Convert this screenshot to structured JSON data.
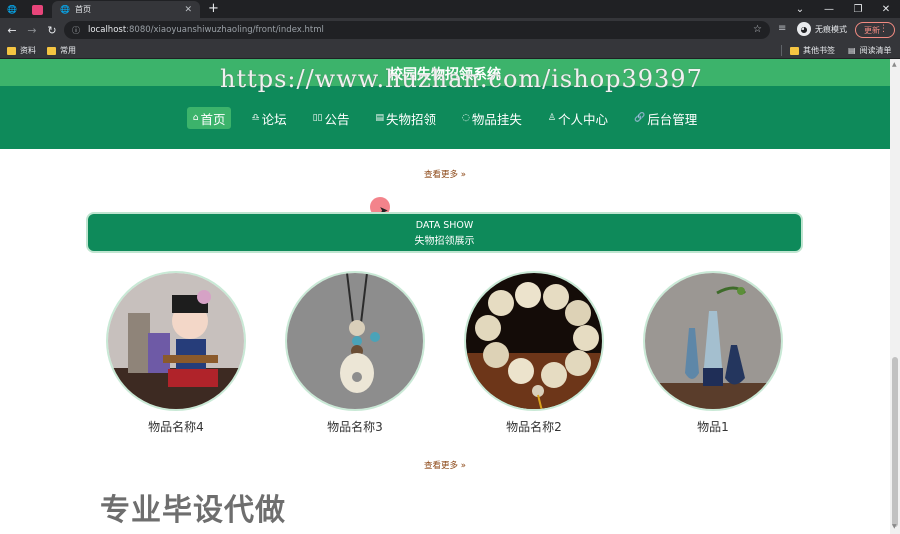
{
  "browser": {
    "tabs": [
      {
        "title": ""
      },
      {
        "title": ""
      },
      {
        "title": "首页"
      }
    ],
    "url_host": "localhost",
    "url_path": ":8080/xiaoyuanshiwuzhaoling/front/index.html",
    "incognito_label": "无痕模式",
    "update_label": "更新",
    "bookmarks": [
      {
        "label": "资料"
      },
      {
        "label": "常用"
      }
    ],
    "bookmarks_right": [
      {
        "label": "其他书签"
      },
      {
        "label": "阅读清单"
      }
    ]
  },
  "site": {
    "title": "校园失物招领系统",
    "watermark": "https://www.huzhan.com/ishop39397",
    "nav": [
      {
        "label": "首页",
        "icon": "home-icon",
        "glyph": "⌂",
        "active": true
      },
      {
        "label": "论坛",
        "icon": "forum-icon",
        "glyph": "♎",
        "active": false
      },
      {
        "label": "公告",
        "icon": "notice-icon",
        "glyph": "▯▯",
        "active": false
      },
      {
        "label": "失物招领",
        "icon": "lost-found-icon",
        "glyph": "▤",
        "active": false
      },
      {
        "label": "物品挂失",
        "icon": "report-icon",
        "glyph": "◌",
        "active": false
      },
      {
        "label": "个人中心",
        "icon": "user-icon",
        "glyph": "♙",
        "active": false
      },
      {
        "label": "后台管理",
        "icon": "link-icon",
        "glyph": "🔗",
        "active": false
      }
    ]
  },
  "main": {
    "more_top": "查看更多 »",
    "banner_en": "DATA SHOW",
    "banner_cn": "失物招领展示",
    "products": [
      {
        "name": "物品名称4"
      },
      {
        "name": "物品名称3"
      },
      {
        "name": "物品名称2"
      },
      {
        "name": "物品1"
      }
    ],
    "more_bottom": "查看更多 »",
    "overlay_text": "专业毕设代做"
  },
  "colors": {
    "header_green": "#0e8a5a",
    "header_top_green": "#3cb36b",
    "more_link": "#8b4513"
  }
}
